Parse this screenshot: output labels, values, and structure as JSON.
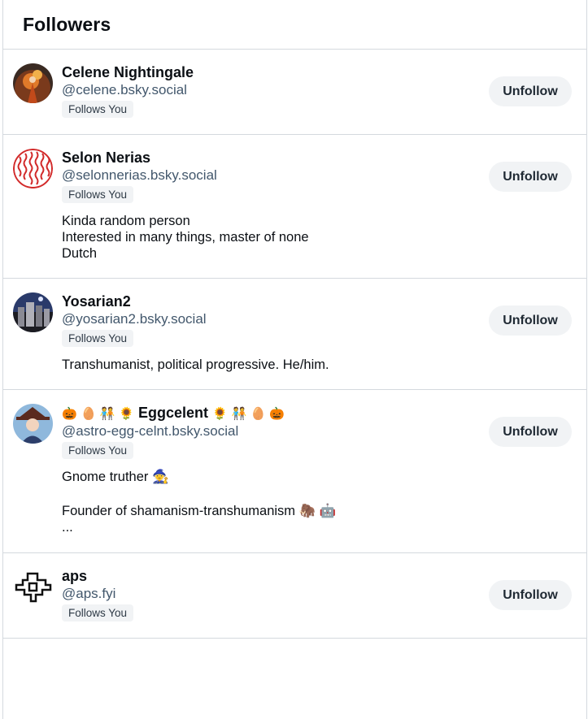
{
  "header": {
    "title": "Followers"
  },
  "followers": [
    {
      "name": "Celene Nightingale",
      "handle": "@celene.bsky.social",
      "badge": "Follows You",
      "bio": [],
      "button": "Unfollow"
    },
    {
      "name": "Selon Nerias",
      "handle": "@selonnerias.bsky.social",
      "badge": "Follows You",
      "bio": [
        "Kinda random person",
        "Interested in many things, master of none",
        "Dutch"
      ],
      "button": "Unfollow"
    },
    {
      "name": "Yosarian2",
      "handle": "@yosarian2.bsky.social",
      "badge": "Follows You",
      "bio": [
        "Transhumanist, political progressive. He/him."
      ],
      "button": "Unfollow"
    },
    {
      "name_prefix": "🎃 🥚 🧑‍🤝‍🧑 🌻",
      "name": "Eggcelent",
      "name_suffix": "🌻 🧑‍🤝‍🧑 🥚 🎃",
      "handle": "@astro-egg-celnt.bsky.social",
      "badge": "Follows You",
      "bio": [
        "Gnome truther 🧙",
        "",
        "Founder of shamanism-transhumanism 🦣 🤖",
        "..."
      ],
      "button": "Unfollow"
    },
    {
      "name": "aps",
      "handle": "@aps.fyi",
      "badge": "Follows You",
      "bio": [],
      "button": "Unfollow"
    }
  ]
}
